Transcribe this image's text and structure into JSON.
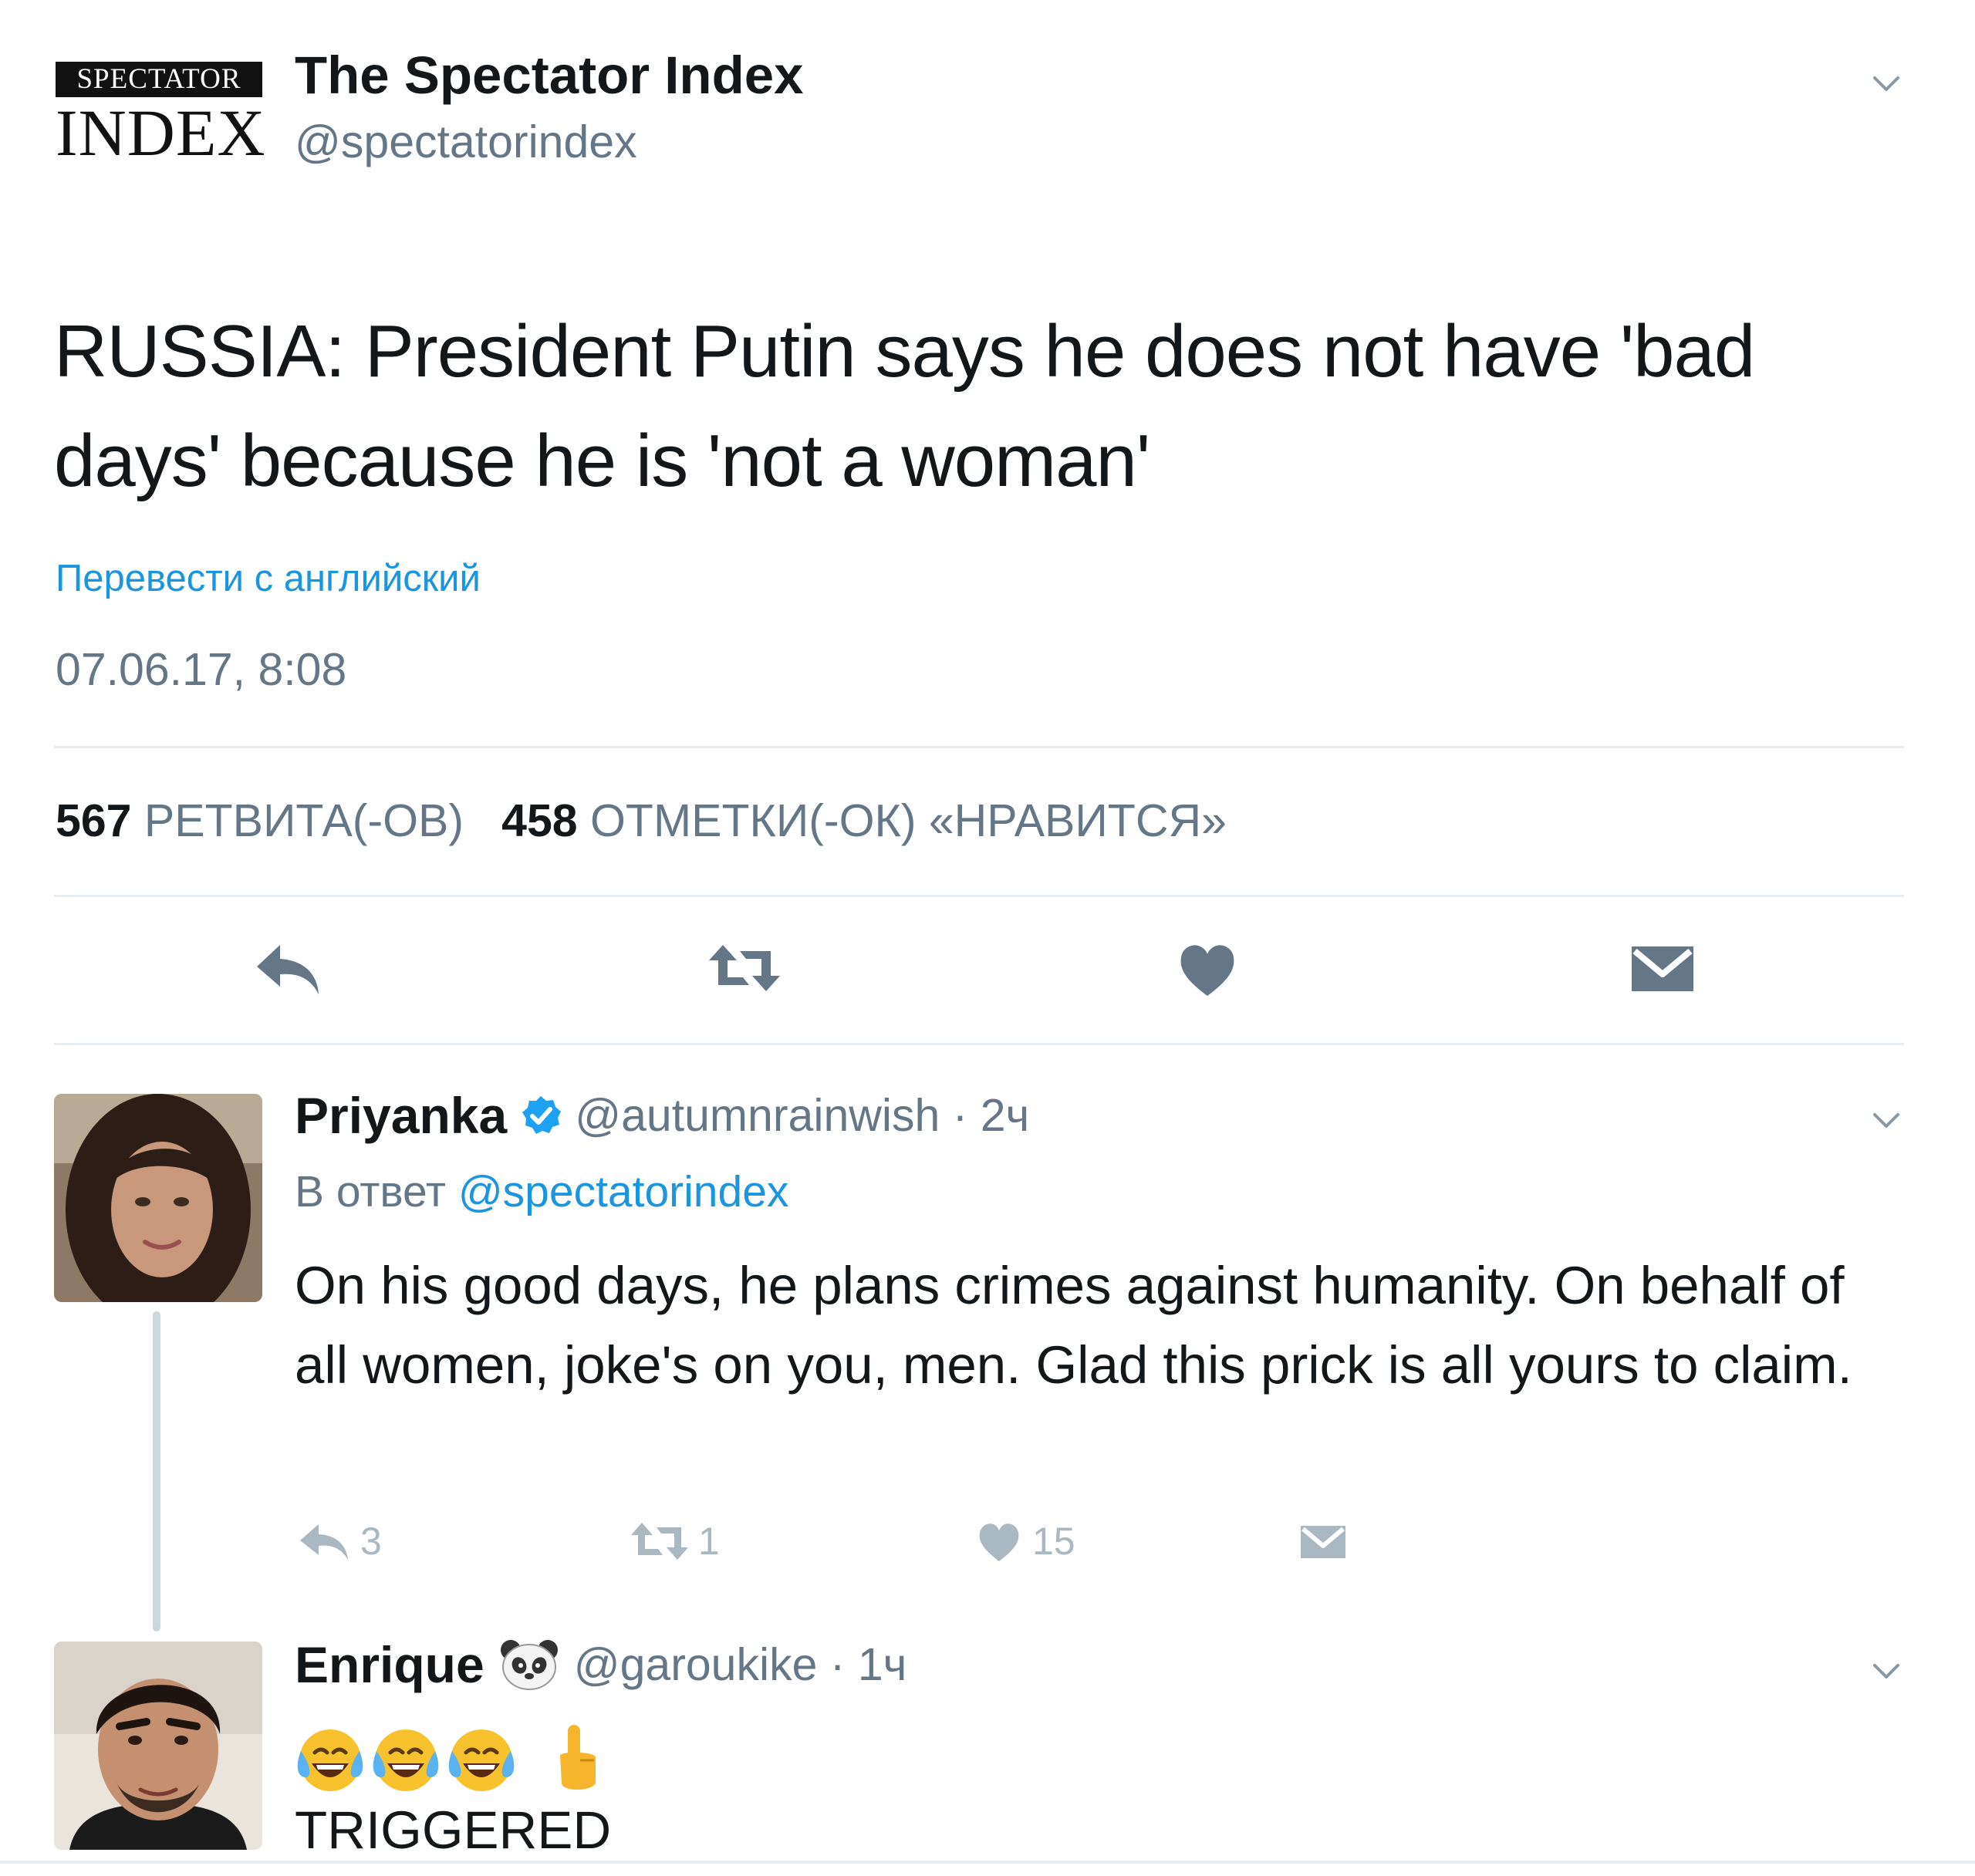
{
  "main_tweet": {
    "logo_top": "SPECTATOR",
    "logo_bottom": "INDEX",
    "name": "The Spectator Index",
    "handle": "@spectatorindex",
    "text": "RUSSIA: President Putin says he does not have 'bad days' because he is 'not a woman'",
    "translate_link": "Перевести с английский",
    "timestamp": "07.06.17, 8:08",
    "retweets_count": "567",
    "retweets_label": "РЕТВИТА(-ОВ)",
    "likes_count": "458",
    "likes_label": "ОТМЕТКИ(-ОК) «НРАВИТСЯ»"
  },
  "replies": [
    {
      "name": "Priyanka",
      "handle": "@autumnrainwish · 2ч",
      "reply_prefix": "В ответ",
      "reply_to": "@spectatorindex",
      "text": "On his good days, he plans crimes against humanity. On behalf of all women, joke's on you, men. Glad this prick is all yours to claim.",
      "reply_count": "3",
      "retweet_count": "1",
      "like_count": "15",
      "verified": true
    },
    {
      "name": "Enrique",
      "handle": "@garoukike · 1ч",
      "emoji_text": "😂😂😂 👆",
      "text": "TRIGGERED"
    }
  ],
  "colors": {
    "link": "#1b95e0",
    "secondary_text": "#657786",
    "action_icon": "#657786",
    "reply_action_icon": "#aab8c2",
    "divider": "#e6ecf0"
  }
}
